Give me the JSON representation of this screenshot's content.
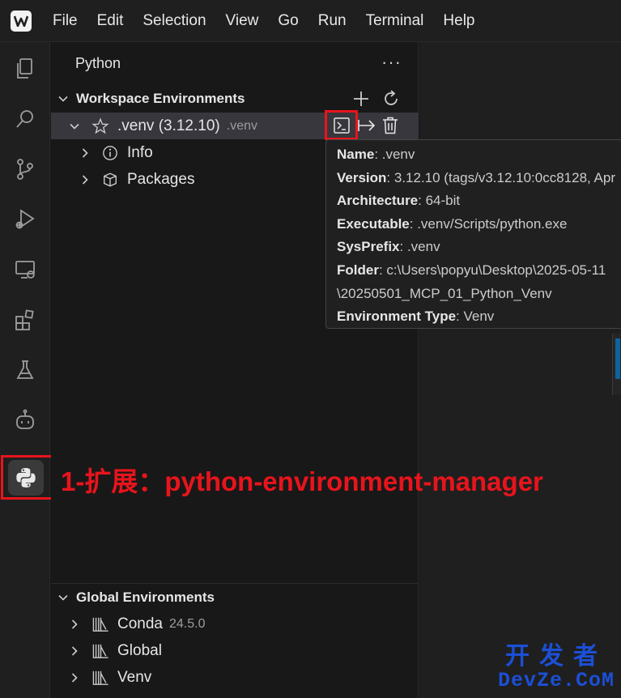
{
  "menu": {
    "items": [
      "File",
      "Edit",
      "Selection",
      "View",
      "Go",
      "Run",
      "Terminal",
      "Help"
    ]
  },
  "sidebar": {
    "title": "Python",
    "more_label": "···",
    "workspace": {
      "header": "Workspace Environments",
      "env": {
        "name": ".venv (3.12.10)",
        "detail": ".venv",
        "children": [
          "Info",
          "Packages"
        ]
      }
    },
    "global": {
      "header": "Global Environments",
      "items": [
        {
          "name": "Conda",
          "version": "24.5.0"
        },
        {
          "name": "Global",
          "version": ""
        },
        {
          "name": "Venv",
          "version": ""
        }
      ]
    }
  },
  "tooltip": {
    "lines": [
      {
        "key": "Name",
        "value": ": .venv"
      },
      {
        "key": "Version",
        "value": ": 3.12.10 (tags/v3.12.10:0cc8128, Apr"
      },
      {
        "key": "Architecture",
        "value": ": 64-bit"
      },
      {
        "key": "Executable",
        "value": ": .venv/Scripts/python.exe"
      },
      {
        "key": "SysPrefix",
        "value": ": .venv"
      },
      {
        "key": "Folder",
        "value": ": c:\\Users\\popyu\\Desktop\\2025-05-11"
      },
      {
        "key": "",
        "value": "\\20250501_MCP_01_Python_Venv"
      },
      {
        "key": "Environment Type",
        "value": ": Venv"
      }
    ]
  },
  "annotation": "1-扩展：python-environment-manager",
  "watermark": {
    "cn": "开发者",
    "en": "DevZe.CoM"
  },
  "colors": {
    "accent_red": "#e8141c",
    "watermark_blue": "#1b4fd6",
    "selection": "#37373d"
  }
}
